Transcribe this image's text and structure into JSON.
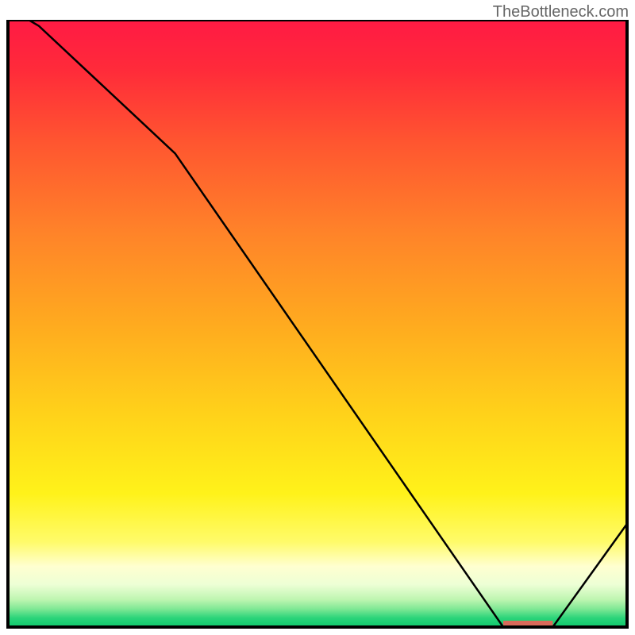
{
  "watermark": "TheBottleneck.com",
  "chart_data": {
    "type": "line",
    "title": "",
    "xlabel": "",
    "ylabel": "",
    "xlim": [
      0,
      100
    ],
    "ylim": [
      0,
      100
    ],
    "x": [
      0,
      5,
      27,
      80,
      88,
      100
    ],
    "values": [
      102,
      99,
      78,
      0,
      0,
      17
    ],
    "gradient_stops": [
      {
        "offset": 0,
        "color": "#ff1a44"
      },
      {
        "offset": 8,
        "color": "#ff2a3a"
      },
      {
        "offset": 20,
        "color": "#ff5530"
      },
      {
        "offset": 35,
        "color": "#ff8329"
      },
      {
        "offset": 50,
        "color": "#ffaa1f"
      },
      {
        "offset": 65,
        "color": "#ffd21a"
      },
      {
        "offset": 78,
        "color": "#fff21a"
      },
      {
        "offset": 86,
        "color": "#fffb6a"
      },
      {
        "offset": 90,
        "color": "#ffffd0"
      },
      {
        "offset": 93,
        "color": "#edffd5"
      },
      {
        "offset": 95.5,
        "color": "#bdf5b0"
      },
      {
        "offset": 97,
        "color": "#80e895"
      },
      {
        "offset": 98.5,
        "color": "#2bd47a"
      },
      {
        "offset": 100,
        "color": "#0ec96c"
      }
    ],
    "marker": {
      "x_start": 80,
      "x_end": 88,
      "color": "#d96a5a"
    },
    "border_color": "#000000"
  }
}
